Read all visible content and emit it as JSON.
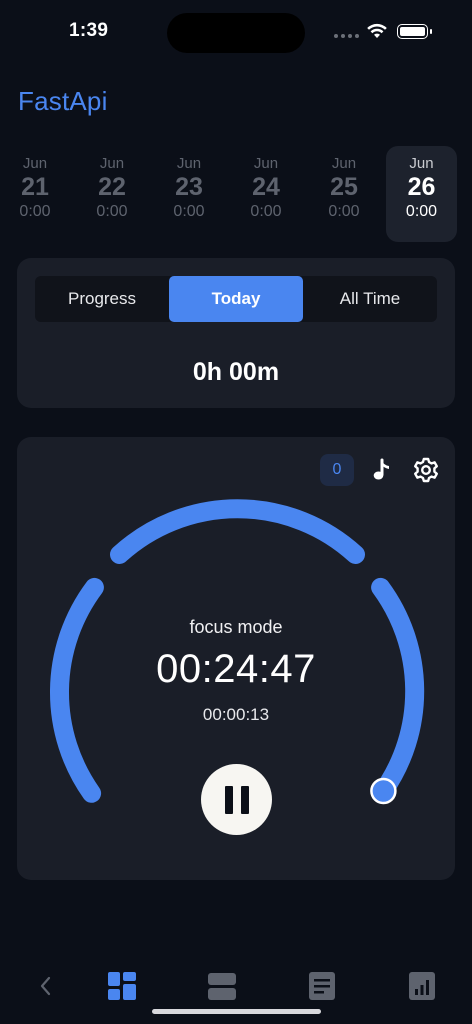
{
  "status_bar": {
    "time": "1:39"
  },
  "app": {
    "title": "FastApi"
  },
  "dates": [
    {
      "month": "Jun",
      "day": "21",
      "duration": "0:00",
      "active": false
    },
    {
      "month": "Jun",
      "day": "22",
      "duration": "0:00",
      "active": false
    },
    {
      "month": "Jun",
      "day": "23",
      "duration": "0:00",
      "active": false
    },
    {
      "month": "Jun",
      "day": "24",
      "duration": "0:00",
      "active": false
    },
    {
      "month": "Jun",
      "day": "25",
      "duration": "0:00",
      "active": false
    },
    {
      "month": "Jun",
      "day": "26",
      "duration": "0:00",
      "active": true
    }
  ],
  "stats": {
    "tabs": [
      {
        "label": "Progress",
        "active": false
      },
      {
        "label": "Today",
        "active": true
      },
      {
        "label": "All Time",
        "active": false
      }
    ],
    "total": "0h 00m"
  },
  "timer": {
    "count_badge": "0",
    "mode": "focus mode",
    "remaining": "00:24:47",
    "elapsed": "00:00:13",
    "progress_fraction": 0.01,
    "icons": {
      "music": "music-note-icon",
      "settings": "gear-icon",
      "pause": "pause-icon"
    }
  },
  "bottom_nav": [
    {
      "name": "back",
      "icon": "chevron-left-icon",
      "active": false
    },
    {
      "name": "dashboard",
      "icon": "grid-icon",
      "active": true
    },
    {
      "name": "sessions",
      "icon": "rows-icon",
      "active": false
    },
    {
      "name": "notes",
      "icon": "document-icon",
      "active": false
    },
    {
      "name": "stats",
      "icon": "bar-chart-icon",
      "active": false
    }
  ],
  "colors": {
    "accent": "#4a86f0",
    "background": "#0b0f18",
    "card": "#1a1e28",
    "muted_text": "#5e636e"
  }
}
